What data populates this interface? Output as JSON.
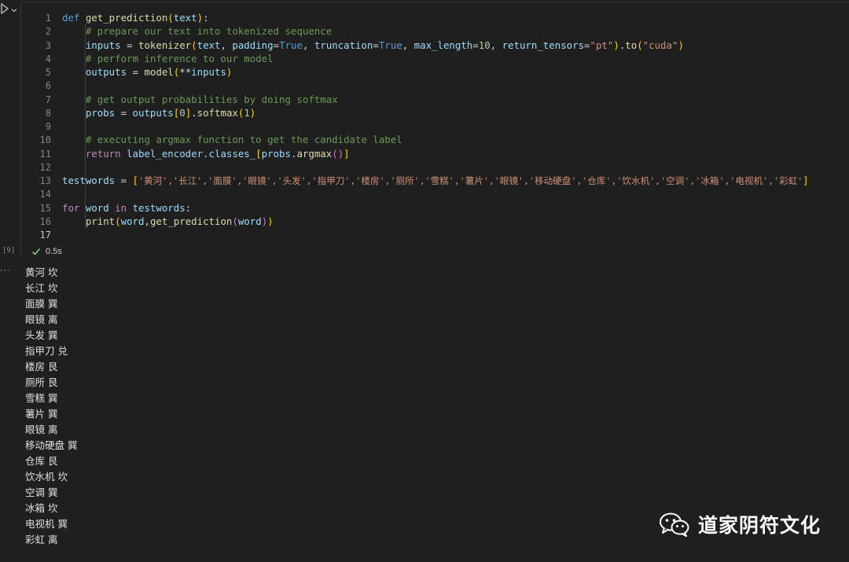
{
  "cell": {
    "execution_count": "[9]",
    "status_time": "0.5s",
    "status_icon": "check-icon",
    "line_numbers": [
      "1",
      "2",
      "3",
      "4",
      "5",
      "6",
      "7",
      "8",
      "9",
      "10",
      "11",
      "12",
      "13",
      "14",
      "15",
      "16",
      "17"
    ],
    "lines": {
      "l1": {
        "def": "def ",
        "fn": "get_prediction",
        "p_open": "(",
        "arg": "text",
        "p_close": ")",
        "colon": ":"
      },
      "l2": {
        "comment": "# prepare our text into tokenized sequence"
      },
      "l3": {
        "var": "inputs",
        "eq": " = ",
        "fn": "tokenizer",
        "p_open": "(",
        "a1": "text",
        "c1": ", ",
        "k1": "padding",
        "e1": "=",
        "v1": "True",
        "c2": ", ",
        "k2": "truncation",
        "e2": "=",
        "v2": "True",
        "c3": ", ",
        "k3": "max_length",
        "e3": "=",
        "v3": "10",
        "c4": ", ",
        "k4": "return_tensors",
        "e4": "=",
        "v4": "\"pt\"",
        "p_close": ")",
        "dot": ".",
        "fn2": "to",
        "p2_open": "(",
        "v5": "\"cuda\"",
        "p2_close": ")"
      },
      "l4": {
        "comment": "# perform inference to our model"
      },
      "l5": {
        "var": "outputs",
        "eq": " = ",
        "fn": "model",
        "p_open": "(",
        "star": "**",
        "arg": "inputs",
        "p_close": ")"
      },
      "l7": {
        "comment": "# get output probabilities by doing softmax"
      },
      "l8": {
        "var": "probs",
        "eq": " = ",
        "obj": "outputs",
        "b_open": "[",
        "idx": "0",
        "b_close": "]",
        "dot": ".",
        "fn": "softmax",
        "p_open": "(",
        "arg": "1",
        "p_close": ")"
      },
      "l10": {
        "comment": "# executing argmax function to get the candidate label"
      },
      "l11": {
        "ret": "return ",
        "obj": "label_encoder",
        "dot": ".",
        "attr": "classes_",
        "b_open": "[",
        "obj2": "probs",
        "dot2": ".",
        "fn": "argmax",
        "p_open": "(",
        "p_close": ")",
        "b_close": "]"
      },
      "l13": {
        "var": "testwords",
        "eq": " = ",
        "b_open": "[",
        "items": "'黄河','长江','面膜','眼镜','头发','指甲刀','楼房','厕所','雪糕','薯片','眼镜','移动硬盘','仓库','饮水机','空调','冰箱','电视机','彩虹'",
        "b_close": "]"
      },
      "l15": {
        "for": "for ",
        "var": "word",
        "in": " in ",
        "obj": "testwords",
        "colon": ":"
      },
      "l16": {
        "fn": "print",
        "p_open": "(",
        "a1": "word",
        "c1": ",",
        "fn2": "get_prediction",
        "p2_open": "(",
        "a2": "word",
        "p2_close": ")",
        "p_close": ")"
      }
    }
  },
  "output": {
    "gutter": "···",
    "lines": [
      "黄河 坎",
      "长江 坎",
      "面膜 巽",
      "眼镜 离",
      "头发 巽",
      "指甲刀 兑",
      "楼房 艮",
      "厕所 艮",
      "雪糕 巽",
      "薯片 巽",
      "眼镜 离",
      "移动硬盘 巽",
      "仓库 艮",
      "饮水机 坎",
      "空调 巽",
      "冰箱 坎",
      "电视机 巽",
      "彩虹 离"
    ]
  },
  "watermark": {
    "icon": "wechat-icon",
    "text": "道家阴符文化"
  },
  "colors": {
    "background": "#1f1f1f",
    "keyword": "#569cd6",
    "control_keyword": "#c586c0",
    "function": "#dcdcaa",
    "variable": "#9cdcfe",
    "string": "#ce9178",
    "number": "#b5cea8",
    "comment": "#6a9955",
    "success": "#89d185"
  }
}
